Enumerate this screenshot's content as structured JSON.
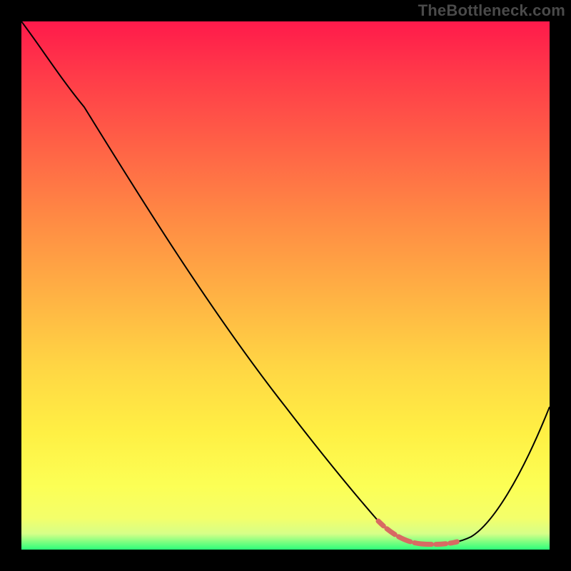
{
  "watermark": {
    "text": "TheBottleneck.com"
  },
  "colors": {
    "curve_black": "#000000",
    "curve_red": "#d86a63"
  },
  "chart_data": {
    "type": "line",
    "title": "",
    "xlabel": "",
    "ylabel": "",
    "xlim": [
      0,
      100
    ],
    "ylim": [
      0,
      100
    ],
    "grid": false,
    "legend": false,
    "series": [
      {
        "name": "main-curve",
        "color": "#000000",
        "x": [
          0,
          6,
          12,
          20,
          30,
          40,
          50,
          60,
          66,
          70,
          74,
          78,
          82,
          86,
          90,
          95,
          100
        ],
        "values": [
          100,
          95,
          88,
          78,
          65,
          51,
          38,
          24,
          14,
          8,
          4,
          2,
          2,
          3,
          8,
          18,
          32
        ]
      },
      {
        "name": "highlight-min-segment",
        "color": "#d86a63",
        "x": [
          70,
          73,
          76,
          79,
          82,
          85,
          88
        ],
        "values": [
          4.5,
          3.0,
          2.2,
          2.0,
          2.0,
          2.5,
          3.5
        ]
      }
    ],
    "annotations": []
  }
}
